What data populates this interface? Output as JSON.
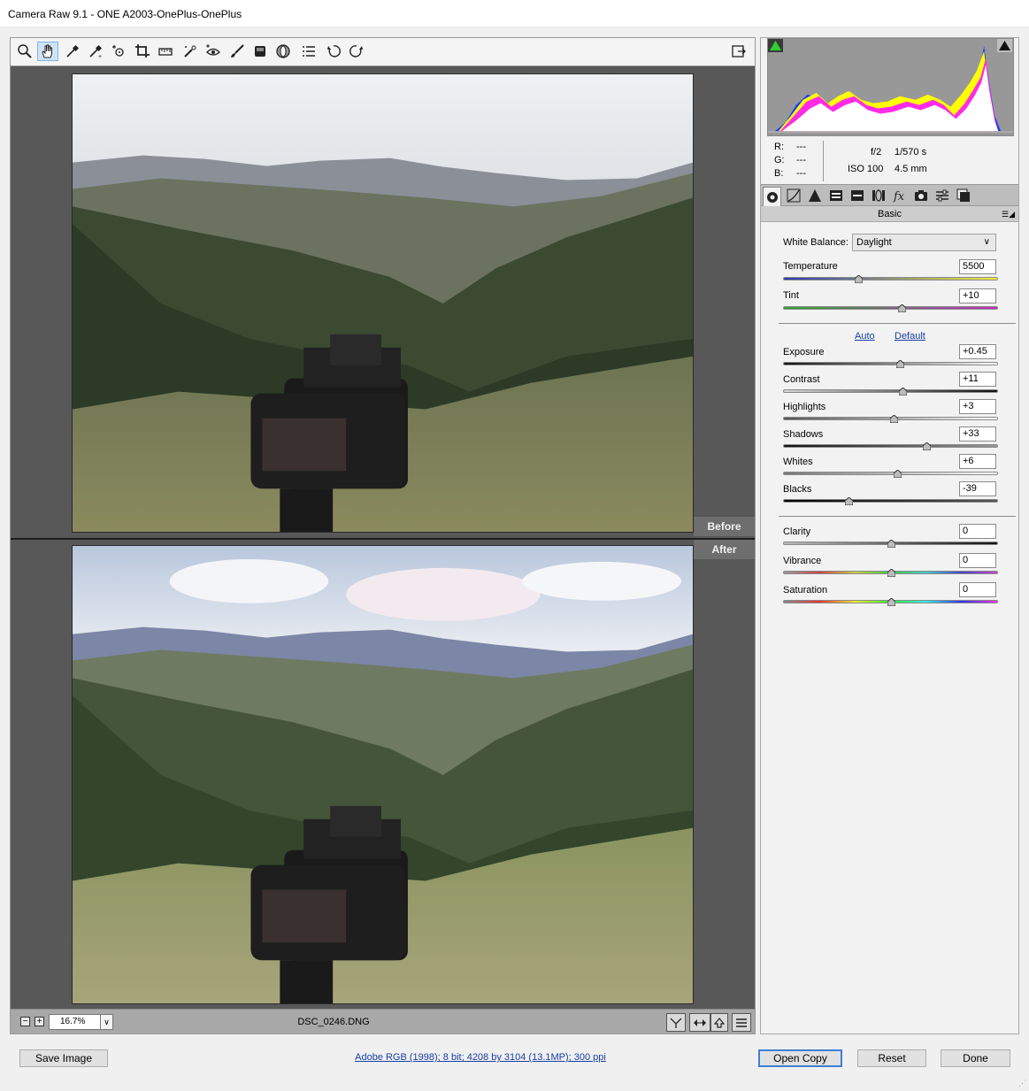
{
  "window": {
    "title": "Camera Raw 9.1  -  ONE A2003-OnePlus-OnePlus"
  },
  "toolbar": {
    "tools": [
      {
        "name": "zoom-tool-icon"
      },
      {
        "name": "hand-tool-icon",
        "active": true
      },
      {
        "name": "white-balance-tool-icon"
      },
      {
        "name": "color-sampler-tool-icon"
      },
      {
        "name": "targeted-adjustment-tool-icon"
      },
      {
        "name": "crop-tool-icon"
      },
      {
        "name": "straighten-tool-icon"
      },
      {
        "name": "spot-removal-tool-icon"
      },
      {
        "name": "red-eye-removal-icon"
      },
      {
        "name": "adjustment-brush-icon"
      },
      {
        "name": "graduated-filter-icon"
      },
      {
        "name": "radial-filter-icon"
      },
      {
        "name": "preferences-icon"
      },
      {
        "name": "rotate-left-icon"
      },
      {
        "name": "rotate-right-icon"
      }
    ],
    "fullscreen_icon": "toggle-fullscreen-icon"
  },
  "preview": {
    "before_label": "Before",
    "after_label": "After"
  },
  "statusbar": {
    "zoom_value": "16.7%",
    "filename": "DSC_0246.DNG"
  },
  "readout": {
    "r_label": "R:",
    "r_value": "---",
    "g_label": "G:",
    "g_value": "---",
    "b_label": "B:",
    "b_value": "---",
    "aperture": "f/2",
    "shutter": "1/570 s",
    "iso": "ISO 100",
    "focal": "4.5 mm"
  },
  "panel": {
    "section_title": "Basic",
    "white_balance_label": "White Balance:",
    "white_balance_value": "Daylight",
    "auto_link": "Auto",
    "default_link": "Default",
    "sliders": {
      "temperature": {
        "label": "Temperature",
        "value": "5500",
        "fraction": 0.35
      },
      "tint": {
        "label": "Tint",
        "value": "+10",
        "fraction": 0.55
      },
      "exposure": {
        "label": "Exposure",
        "value": "+0.45",
        "fraction": 0.545
      },
      "contrast": {
        "label": "Contrast",
        "value": "+11",
        "fraction": 0.555
      },
      "highlights": {
        "label": "Highlights",
        "value": "+3",
        "fraction": 0.515
      },
      "shadows": {
        "label": "Shadows",
        "value": "+33",
        "fraction": 0.665
      },
      "whites": {
        "label": "Whites",
        "value": "+6",
        "fraction": 0.53
      },
      "blacks": {
        "label": "Blacks",
        "value": "-39",
        "fraction": 0.305
      },
      "clarity": {
        "label": "Clarity",
        "value": "0",
        "fraction": 0.5
      },
      "vibrance": {
        "label": "Vibrance",
        "value": "0",
        "fraction": 0.5
      },
      "saturation": {
        "label": "Saturation",
        "value": "0",
        "fraction": 0.5
      }
    }
  },
  "footer": {
    "save_label": "Save Image",
    "info_text": "Adobe RGB (1998); 8 bit; 4208 by 3104 (13.1MP); 300 ppi",
    "open_copy_label": "Open Copy",
    "reset_label": "Reset",
    "done_label": "Done"
  },
  "colors": {
    "accent": "#3c7fd4",
    "link": "#1a3ea6",
    "panel_bg": "#585858"
  }
}
